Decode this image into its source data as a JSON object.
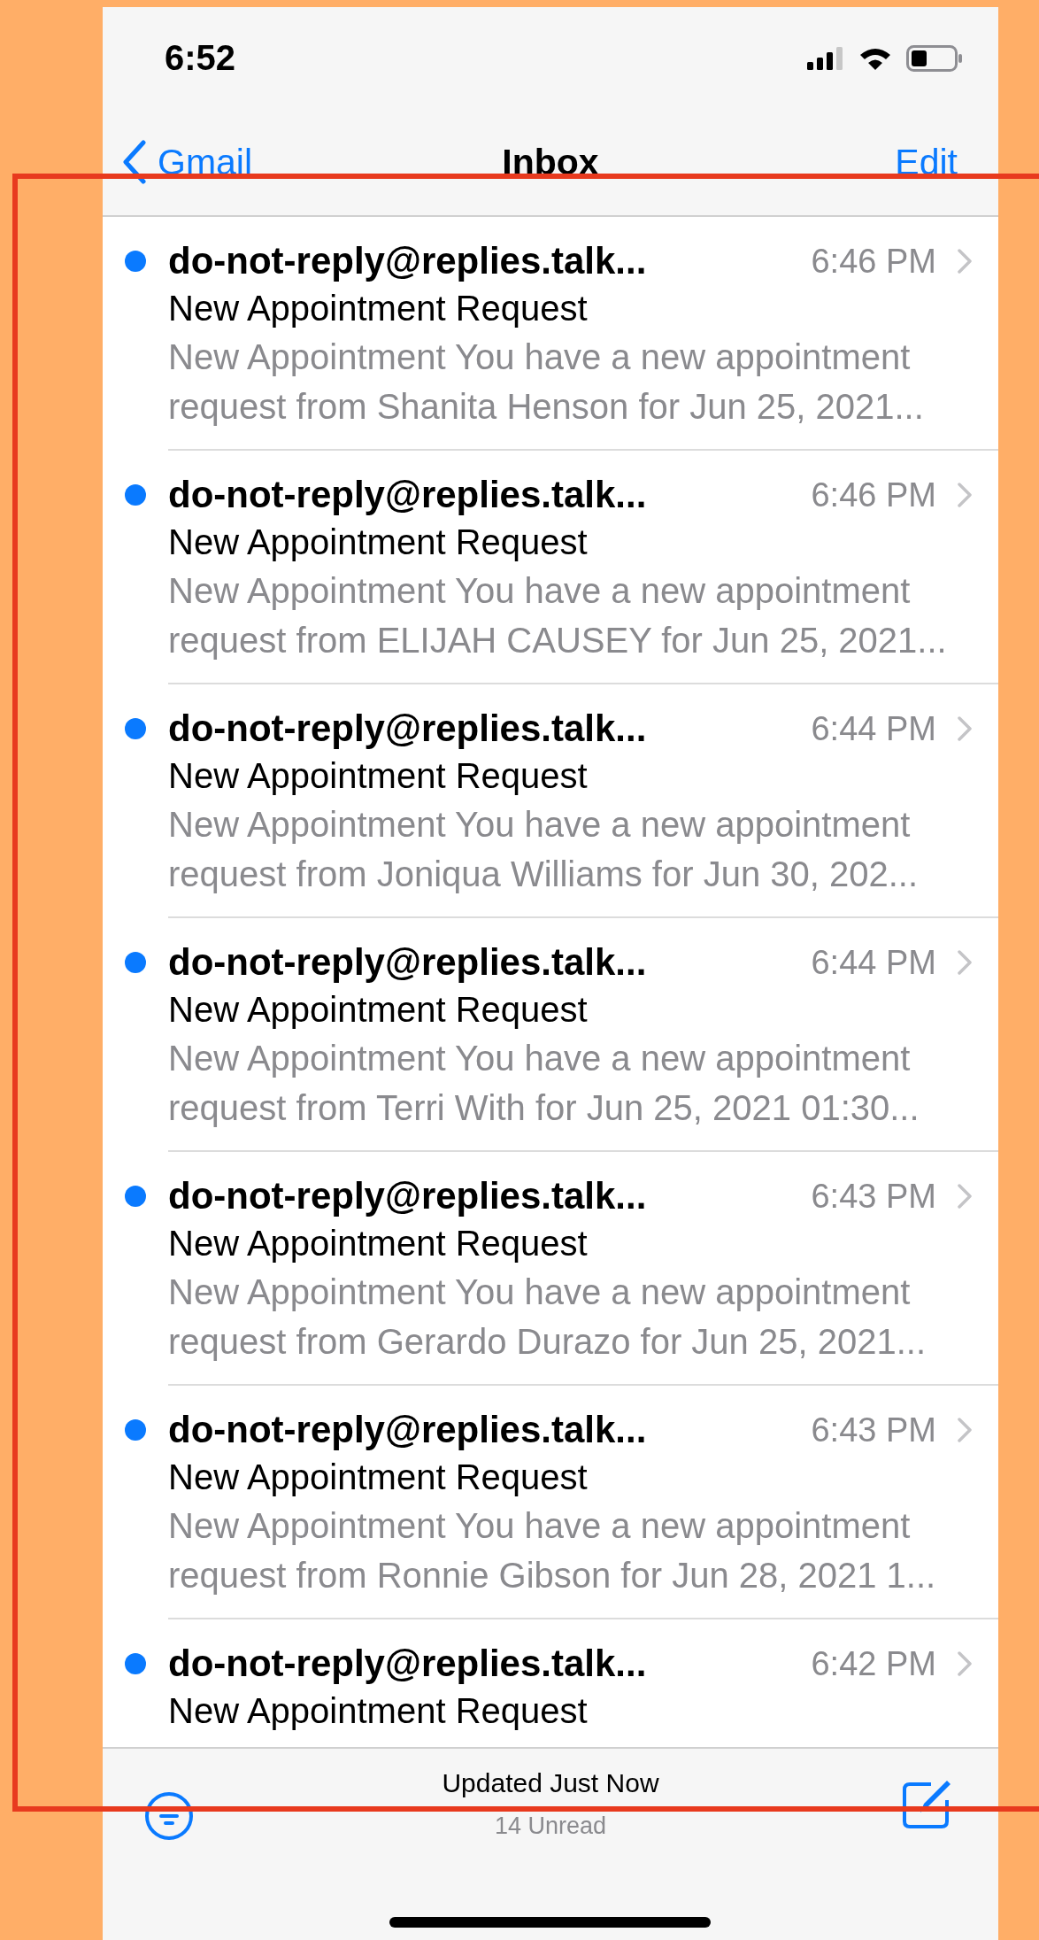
{
  "status_bar": {
    "time": "6:52"
  },
  "nav": {
    "back": "Gmail",
    "title": "Inbox",
    "action": "Edit"
  },
  "messages": [
    {
      "sender": "do-not-reply@replies.talk...",
      "time": "6:46 PM",
      "subject": "New Appointment Request",
      "preview": "New Appointment You have a new appointment request from Shanita Henson for Jun 25, 2021...",
      "unread": true
    },
    {
      "sender": "do-not-reply@replies.talk...",
      "time": "6:46 PM",
      "subject": "New Appointment Request",
      "preview": "New Appointment You have a new appointment request from ELIJAH CAUSEY for Jun 25, 2021...",
      "unread": true
    },
    {
      "sender": "do-not-reply@replies.talk...",
      "time": "6:44 PM",
      "subject": "New Appointment Request",
      "preview": "New Appointment You have a new appointment request from Joniqua Williams for Jun 30, 202...",
      "unread": true
    },
    {
      "sender": "do-not-reply@replies.talk...",
      "time": "6:44 PM",
      "subject": "New Appointment Request",
      "preview": "New Appointment You have a new appointment request from Terri With for Jun 25, 2021 01:30...",
      "unread": true
    },
    {
      "sender": "do-not-reply@replies.talk...",
      "time": "6:43 PM",
      "subject": "New Appointment Request",
      "preview": "New Appointment You have a new appointment request from Gerardo Durazo for Jun 25, 2021...",
      "unread": true
    },
    {
      "sender": "do-not-reply@replies.talk...",
      "time": "6:43 PM",
      "subject": "New Appointment Request",
      "preview": "New Appointment You have a new appointment request from Ronnie Gibson for Jun 28, 2021 1...",
      "unread": true
    },
    {
      "sender": "do-not-reply@replies.talk...",
      "time": "6:42 PM",
      "subject": "New Appointment Request",
      "unread": true
    }
  ],
  "toolbar": {
    "status": "Updated Just Now",
    "unread_count": "14 Unread"
  }
}
